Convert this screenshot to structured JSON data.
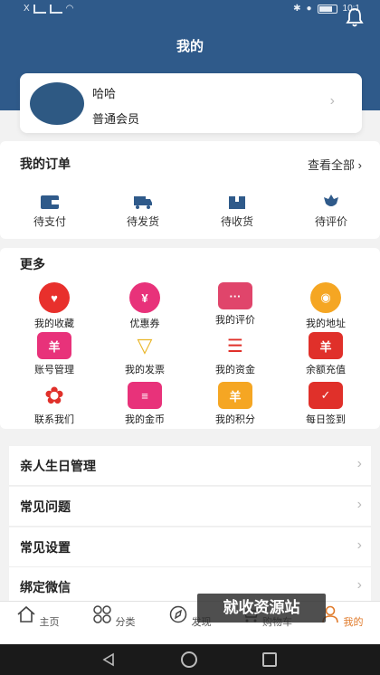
{
  "status_bar": {
    "carrier": "X",
    "time": "10:1"
  },
  "page_title": "我的",
  "profile": {
    "name": "哈哈",
    "member_level": "普通会员"
  },
  "orders": {
    "title": "我的订单",
    "view_all": "查看全部",
    "items": [
      {
        "label": "待支付",
        "icon": "wallet-icon"
      },
      {
        "label": "待发货",
        "icon": "truck-icon"
      },
      {
        "label": "待收货",
        "icon": "package-icon"
      },
      {
        "label": "待评价",
        "icon": "flower-icon"
      }
    ]
  },
  "more": {
    "title": "更多",
    "items": [
      {
        "label": "我的收藏",
        "icon": "heart-icon",
        "color": "#e8302c"
      },
      {
        "label": "优惠券",
        "icon": "yen-icon",
        "color": "#e8327a"
      },
      {
        "label": "我的评价",
        "icon": "comment-icon",
        "color": "#e0456b"
      },
      {
        "label": "我的地址",
        "icon": "location-icon",
        "color": "#f5a623"
      },
      {
        "label": "账号管理",
        "icon": "card-icon",
        "color": "#e8327a"
      },
      {
        "label": "我的发票",
        "icon": "diamond-icon",
        "color": "#e9b62a"
      },
      {
        "label": "我的资金",
        "icon": "coins-icon",
        "color": "#e0302a"
      },
      {
        "label": "余额充值",
        "icon": "ticket-icon",
        "color": "#e0302a"
      },
      {
        "label": "联系我们",
        "icon": "gear-icon",
        "color": "#e0302a"
      },
      {
        "label": "我的金币",
        "icon": "coin-doc-icon",
        "color": "#e8327a"
      },
      {
        "label": "我的积分",
        "icon": "points-icon",
        "color": "#f5a623"
      },
      {
        "label": "每日签到",
        "icon": "calendar-icon",
        "color": "#e0302a"
      }
    ]
  },
  "menu": [
    "亲人生日管理",
    "常见问题",
    "常见设置",
    "绑定微信"
  ],
  "tabbar": [
    {
      "label": "主页",
      "icon": "home-icon"
    },
    {
      "label": "分类",
      "icon": "category-icon"
    },
    {
      "label": "发现",
      "icon": "compass-icon"
    },
    {
      "label": "购物车",
      "icon": "cart-icon"
    },
    {
      "label": "我的",
      "icon": "user-icon"
    }
  ],
  "watermark": "就收资源站",
  "colors": {
    "header": "#2f5a8a",
    "accent": "#e07a2a"
  }
}
